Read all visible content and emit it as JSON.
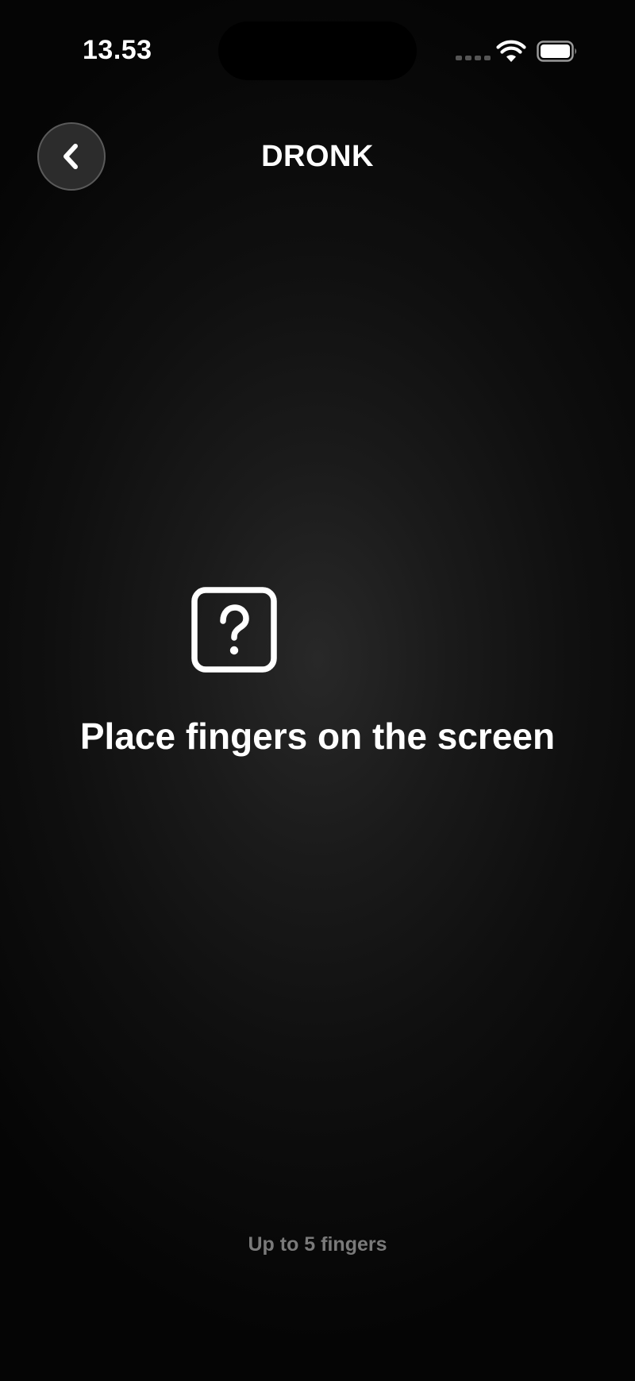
{
  "status_bar": {
    "time": "13.53",
    "icons": [
      "cellular-signal-icon",
      "wifi-icon",
      "battery-icon"
    ]
  },
  "header": {
    "back_icon": "chevron-left-icon",
    "title": "DRONK"
  },
  "main": {
    "icon": "question-mark-square-icon",
    "instruction": "Place fingers on the screen",
    "hint": "Up to 5 fingers"
  },
  "colors": {
    "background_center": "#282828",
    "background_edge": "#050505",
    "text_primary": "#ffffff",
    "text_secondary": "#7a7a7a",
    "back_button_fill": "#2c2c2c",
    "back_button_border": "#5a5a5a"
  }
}
